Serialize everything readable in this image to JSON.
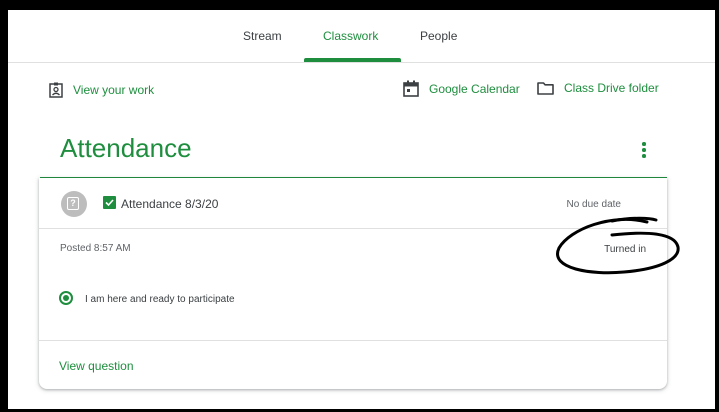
{
  "tabs": [
    {
      "label": "Stream",
      "active": false
    },
    {
      "label": "Classwork",
      "active": true
    },
    {
      "label": "People",
      "active": false
    }
  ],
  "toolbar": {
    "view_work": "View your work",
    "calendar": "Google Calendar",
    "drive": "Class Drive folder"
  },
  "section": {
    "title": "Attendance"
  },
  "assignment": {
    "title": "Attendance 8/3/20",
    "due": "No due date",
    "posted": "Posted 8:57 AM",
    "status": "Turned in",
    "answer": "I am here and ready to participate",
    "view_question": "View question"
  },
  "colors": {
    "accent": "#1e8e3e",
    "text": "#3c4043",
    "muted": "#5f6368"
  }
}
